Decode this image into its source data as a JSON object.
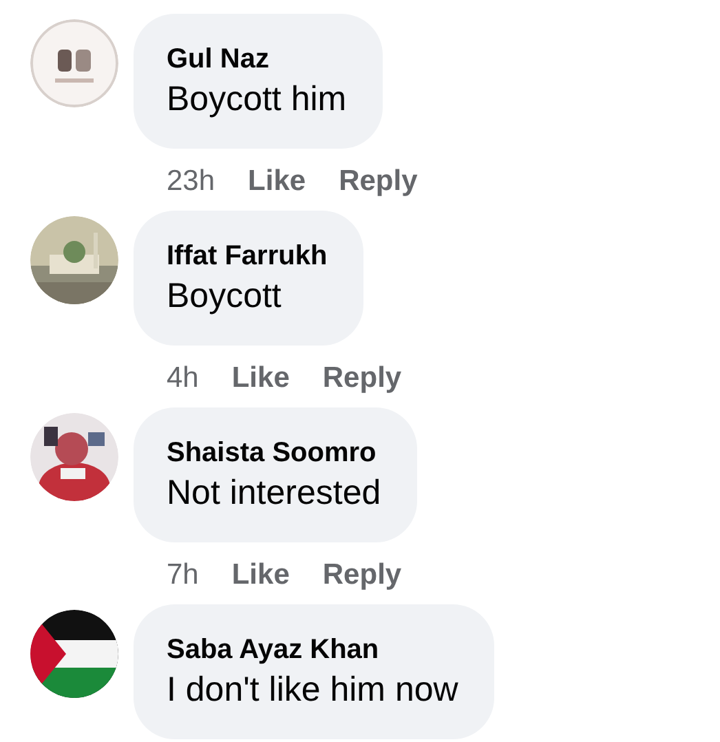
{
  "comments": [
    {
      "author": "Gul Naz",
      "text": "Boycott him",
      "time": "23h",
      "actions": [
        "Like",
        "Reply"
      ]
    },
    {
      "author": "Iffat Farrukh",
      "text": "Boycott",
      "time": "4h",
      "actions": [
        "Like",
        "Reply"
      ]
    },
    {
      "author": "Shaista Soomro",
      "text": "Not interested",
      "time": "7h",
      "actions": [
        "Like",
        "Reply"
      ]
    },
    {
      "author": "Saba Ayaz Khan",
      "text": "I don't like him now"
    }
  ]
}
